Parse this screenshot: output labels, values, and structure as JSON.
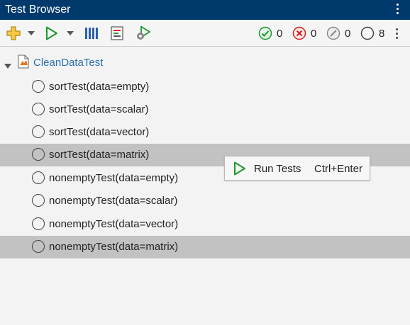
{
  "window": {
    "title": "Test Browser"
  },
  "toolbar": {
    "icons": [
      "add-icon",
      "dropdown-arrow-icon",
      "run-icon",
      "dropdown-arrow-icon",
      "columns-icon",
      "report-icon",
      "run-settings-icon"
    ],
    "status": {
      "passed": "0",
      "failed": "0",
      "incomplete": "0",
      "not_run": "8"
    }
  },
  "tree": {
    "root_label": "CleanDataTest",
    "items": [
      {
        "label": "sortTest(data=empty)",
        "selected": false
      },
      {
        "label": "sortTest(data=scalar)",
        "selected": false
      },
      {
        "label": "sortTest(data=vector)",
        "selected": false
      },
      {
        "label": "sortTest(data=matrix)",
        "selected": true
      },
      {
        "label": "nonemptyTest(data=empty)",
        "selected": false
      },
      {
        "label": "nonemptyTest(data=scalar)",
        "selected": false
      },
      {
        "label": "nonemptyTest(data=vector)",
        "selected": false
      },
      {
        "label": "nonemptyTest(data=matrix)",
        "selected": true
      }
    ]
  },
  "context_menu": {
    "item_label": "Run Tests",
    "item_shortcut": "Ctrl+Enter"
  },
  "colors": {
    "titlebar": "#003a6c",
    "selection": "#c2c2c2",
    "link": "#2a6fb0",
    "pass": "#1a9a2b",
    "fail": "#d42020"
  }
}
